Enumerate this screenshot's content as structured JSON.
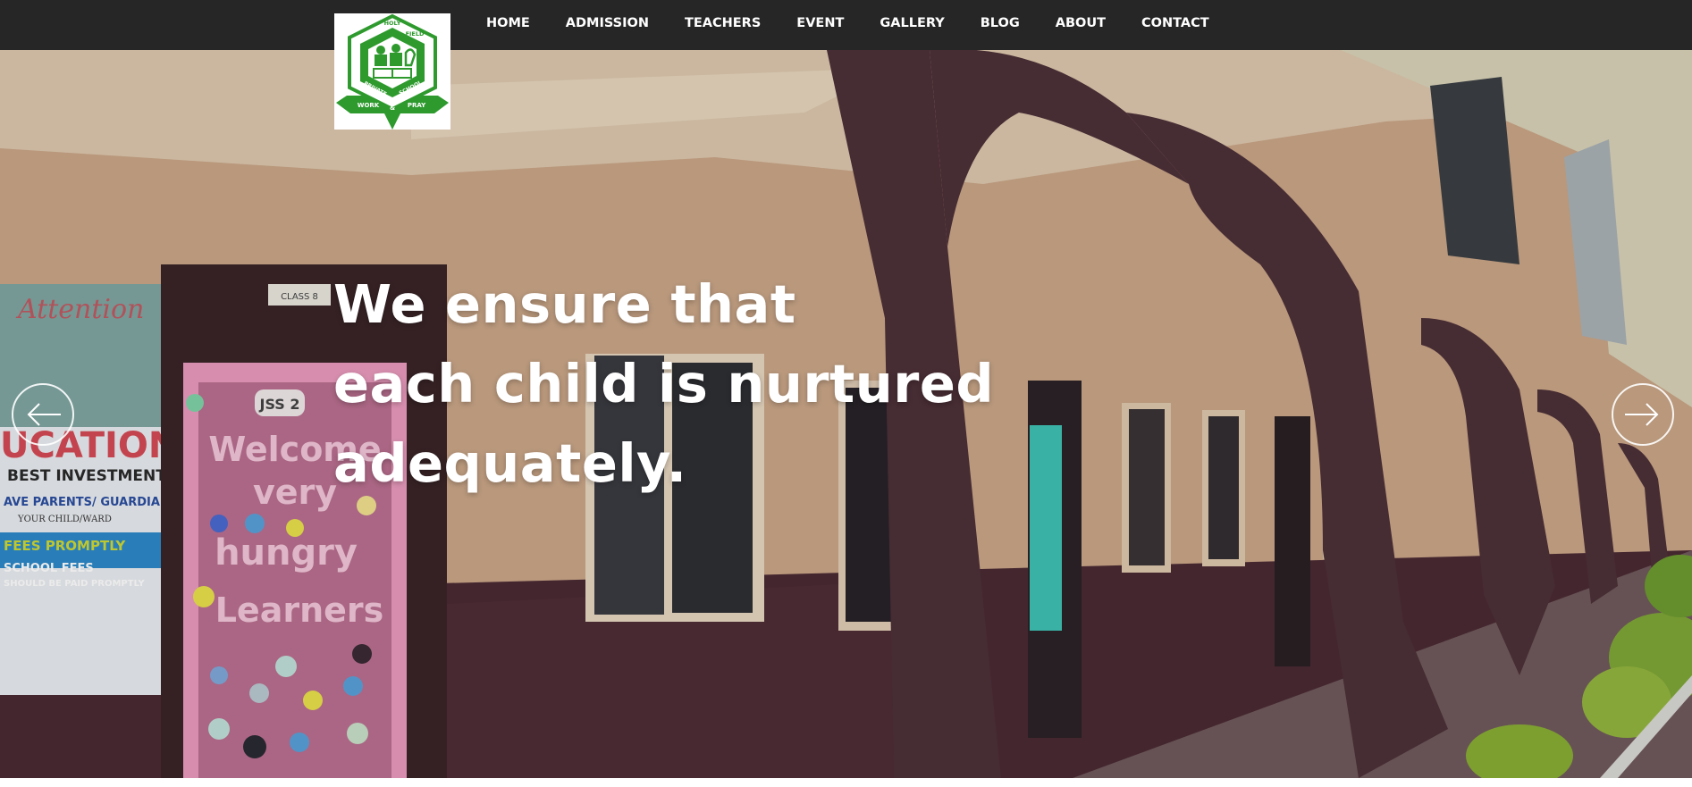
{
  "nav": {
    "items": [
      {
        "label": "HOME"
      },
      {
        "label": "ADMISSION"
      },
      {
        "label": "TEACHERS"
      },
      {
        "label": "EVENT"
      },
      {
        "label": "GALLERY"
      },
      {
        "label": "BLOG"
      },
      {
        "label": "ABOUT"
      },
      {
        "label": "CONTACT"
      }
    ]
  },
  "logo": {
    "top_left": "HOLY",
    "top_right": "FIELD",
    "middle_left": "PRIVATE",
    "middle_right": "SCHOOL",
    "motto_left": "WORK",
    "motto_mid": "&",
    "motto_right": "PRAY",
    "color": "#2e9a2e"
  },
  "hero": {
    "headline_lines": [
      "We ensure that",
      "each child is nurtured",
      "adequately."
    ],
    "photo_texts": {
      "poster_heading": "Attention",
      "poster_big": "UCATION",
      "poster_sub": "BEST INVESTMENT",
      "poster_line1": "AVE PARENTS/ GUARDIAN",
      "poster_line2": "YOUR CHILD/WARD",
      "poster_line3": "FEES PROMPTLY",
      "poster_line4": "SCHOOL FEES",
      "poster_line5": "SHOULD BE PAID PROMPTLY",
      "door_sign": "CLASS 8",
      "board_tag": "JSS 2",
      "board_line1": "Welcome",
      "board_line2": "very",
      "board_line3": "hungry",
      "board_line4": "Learners"
    }
  },
  "controls": {
    "prev_icon": "arrow-left-icon",
    "next_icon": "arrow-right-icon"
  },
  "colors": {
    "topbar": "#262626",
    "wall": "#c9a587",
    "wall_lower": "#4a2a33",
    "pillar": "#4d3038",
    "board": "#b96f90"
  }
}
